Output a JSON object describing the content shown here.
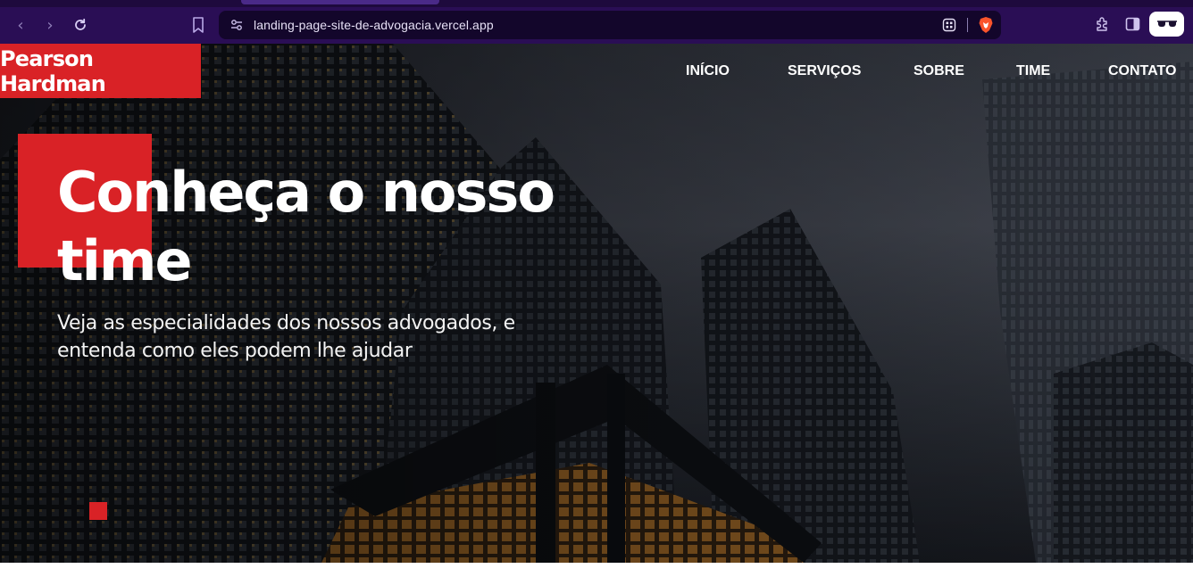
{
  "browser": {
    "url": "landing-page-site-de-advogacia.vercel.app",
    "back_icon": "chevron-left",
    "forward_icon": "chevron-right",
    "reload_icon": "reload",
    "accent_color": "#2a0e55"
  },
  "site": {
    "logo": "Pearson Hardman",
    "brand_color": "#d92226",
    "nav": [
      {
        "label": "INÍCIO"
      },
      {
        "label": "SERVIÇOS"
      },
      {
        "label": "SOBRE"
      },
      {
        "label": "TIME"
      },
      {
        "label": "CONTATO"
      }
    ]
  },
  "hero": {
    "title": "Conheça o nosso time",
    "subtitle": "Veja as especialidades dos nossos advogados, e entenda como eles podem lhe ajudar"
  }
}
